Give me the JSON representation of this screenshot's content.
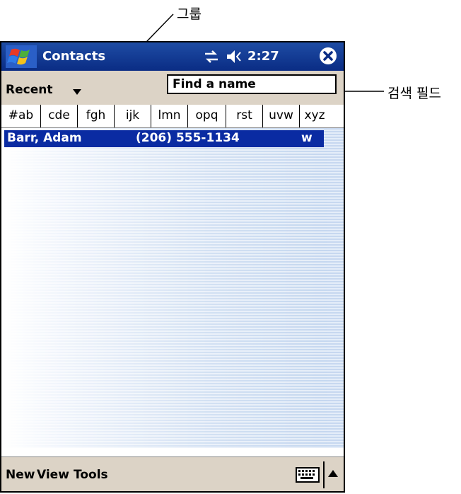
{
  "callouts": {
    "group": "그룹",
    "search_field": "검색 필드"
  },
  "titlebar": {
    "app_title": "Contacts",
    "time": "2:27",
    "icons": [
      "start-flag-icon",
      "connectivity-icon",
      "volume-icon",
      "close-icon"
    ]
  },
  "controls": {
    "category": "Recent",
    "search_placeholder": "Find a name"
  },
  "tabs": [
    "#ab",
    "cde",
    "fgh",
    "ijk",
    "lmn",
    "opq",
    "rst",
    "uvw",
    "xyz"
  ],
  "contacts": [
    {
      "name": "Barr, Adam",
      "phone": "(206) 555-1134",
      "type": "w"
    }
  ],
  "menubar": {
    "items": [
      "New",
      "View",
      "Tools"
    ],
    "icons": [
      "keyboard-icon",
      "arrow-up-icon"
    ]
  },
  "colors": {
    "titlebar": "#1e4ca4",
    "selection": "#0a2ba2",
    "toolbar": "#dcd3c6"
  }
}
